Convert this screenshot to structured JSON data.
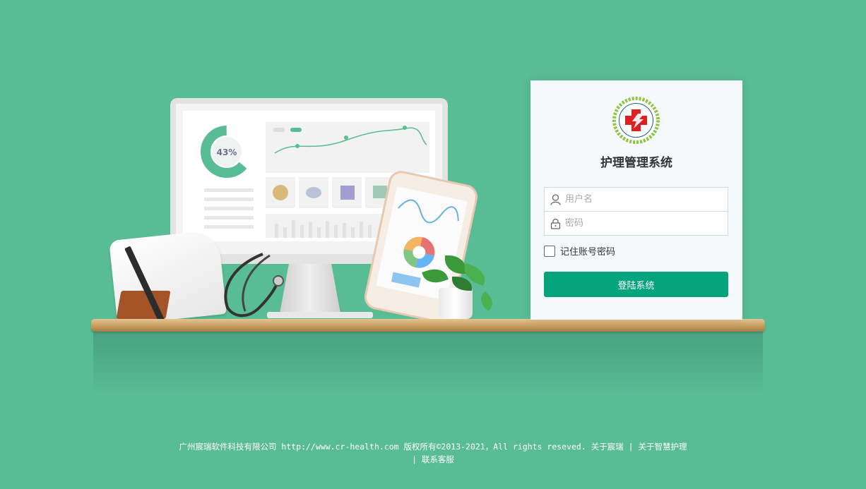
{
  "login": {
    "title": "护理管理系统",
    "username_placeholder": "用户名",
    "password_placeholder": "密码",
    "remember_label": "记住账号密码",
    "submit_label": "登陆系统"
  },
  "illustration": {
    "progress_label": "43%"
  },
  "footer": {
    "company": "广州宸瑞软件科技有限公司",
    "url": "http://www.cr-health.com",
    "copyright": "版权所有©2013-2021，All rights reseved.",
    "link_about_company": "关于宸瑞",
    "separator": "|",
    "link_about_nursing": "关于智慧护理",
    "link_contact": "联系客服"
  },
  "colors": {
    "background": "#58bc95",
    "accent": "#05a47d",
    "logo_red": "#e02020",
    "logo_green": "#8cc63f"
  }
}
